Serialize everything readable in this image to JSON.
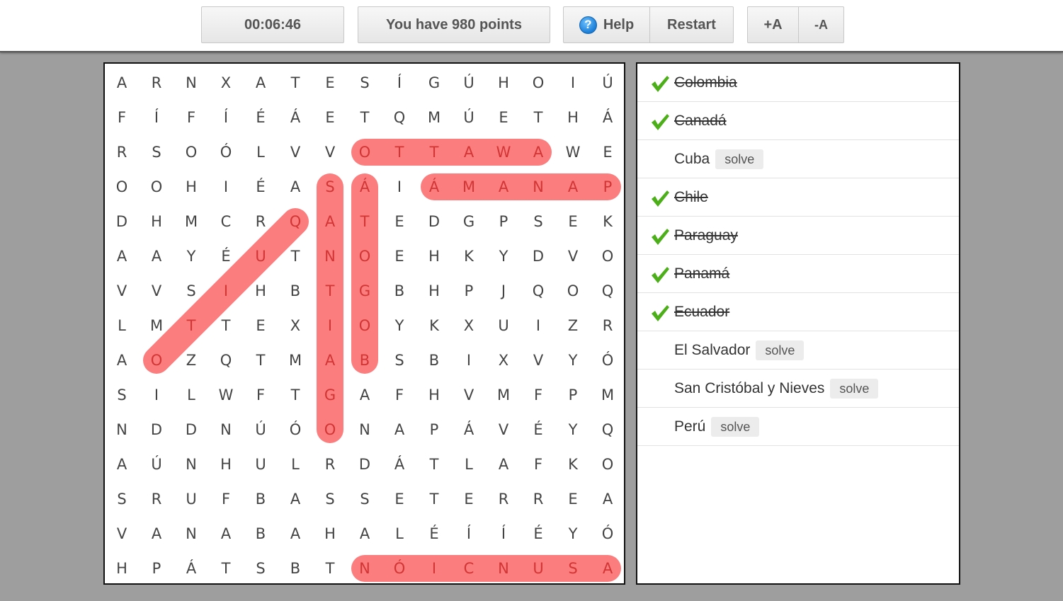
{
  "toolbar": {
    "timer": "00:06:46",
    "points": "You have 980 points",
    "help_label": "Help",
    "help_icon": "question-icon",
    "restart_label": "Restart",
    "font_increase_label": "+A",
    "font_decrease_label": "-A"
  },
  "colors": {
    "highlight": "#fb7d7d",
    "highlight_text": "#d23535",
    "check": "#4caf1a"
  },
  "grid": {
    "rows": [
      [
        "A",
        "R",
        "N",
        "X",
        "A",
        "T",
        "E",
        "S",
        "Í",
        "G",
        "Ú",
        "H",
        "O",
        "I",
        "Ú"
      ],
      [
        "F",
        "Í",
        "F",
        "Í",
        "É",
        "Á",
        "E",
        "T",
        "Q",
        "M",
        "Ú",
        "E",
        "T",
        "H",
        "Á"
      ],
      [
        "R",
        "S",
        "O",
        "Ó",
        "L",
        "V",
        "V",
        "O",
        "T",
        "T",
        "A",
        "W",
        "A",
        "W",
        "E"
      ],
      [
        "O",
        "O",
        "H",
        "I",
        "É",
        "A",
        "S",
        "Á",
        "I",
        "Á",
        "M",
        "A",
        "N",
        "A",
        "P"
      ],
      [
        "D",
        "H",
        "M",
        "C",
        "R",
        "Q",
        "A",
        "T",
        "E",
        "D",
        "G",
        "P",
        "S",
        "E",
        "K"
      ],
      [
        "A",
        "A",
        "Y",
        "É",
        "U",
        "T",
        "N",
        "O",
        "E",
        "H",
        "K",
        "Y",
        "D",
        "V",
        "O"
      ],
      [
        "V",
        "V",
        "S",
        "I",
        "H",
        "B",
        "T",
        "G",
        "B",
        "H",
        "P",
        "J",
        "Q",
        "O",
        "Q"
      ],
      [
        "L",
        "M",
        "T",
        "T",
        "E",
        "X",
        "I",
        "O",
        "Y",
        "K",
        "X",
        "U",
        "I",
        "Z",
        "R"
      ],
      [
        "A",
        "O",
        "Z",
        "Q",
        "T",
        "M",
        "A",
        "B",
        "S",
        "B",
        "I",
        "X",
        "V",
        "Y",
        "Ó"
      ],
      [
        "S",
        "I",
        "L",
        "W",
        "F",
        "T",
        "G",
        "A",
        "F",
        "H",
        "V",
        "M",
        "F",
        "P",
        "M"
      ],
      [
        "N",
        "D",
        "D",
        "N",
        "Ú",
        "Ó",
        "O",
        "N",
        "A",
        "P",
        "Á",
        "V",
        "É",
        "Y",
        "Q"
      ],
      [
        "A",
        "Ú",
        "N",
        "H",
        "U",
        "L",
        "R",
        "D",
        "Á",
        "T",
        "L",
        "A",
        "F",
        "K",
        "O"
      ],
      [
        "S",
        "R",
        "U",
        "F",
        "B",
        "A",
        "S",
        "S",
        "E",
        "T",
        "E",
        "R",
        "R",
        "E",
        "A"
      ],
      [
        "V",
        "A",
        "N",
        "A",
        "B",
        "A",
        "H",
        "A",
        "L",
        "É",
        "Í",
        "Í",
        "É",
        "Y",
        "Ó"
      ],
      [
        "H",
        "P",
        "Á",
        "T",
        "S",
        "B",
        "T",
        "N",
        "Ó",
        "I",
        "C",
        "N",
        "U",
        "S",
        "A"
      ]
    ],
    "found_words": [
      {
        "word": "OTTAWA",
        "from": [
          2,
          7
        ],
        "to": [
          2,
          12
        ]
      },
      {
        "word": "PANAMÁ",
        "from": [
          3,
          14
        ],
        "to": [
          3,
          9
        ]
      },
      {
        "word": "SANTIAGO",
        "from": [
          3,
          6
        ],
        "to": [
          10,
          6
        ]
      },
      {
        "word": "ÁTOGOB",
        "from": [
          3,
          7
        ],
        "to": [
          8,
          7
        ]
      },
      {
        "word": "QUITO",
        "from": [
          4,
          5
        ],
        "to": [
          8,
          1
        ]
      },
      {
        "word": "ASUNCIÓN",
        "from": [
          14,
          14
        ],
        "to": [
          14,
          7
        ]
      }
    ]
  },
  "word_list": [
    {
      "label": "Colombia",
      "found": true
    },
    {
      "label": "Canadá",
      "found": true
    },
    {
      "label": "Cuba",
      "found": false,
      "action": "solve"
    },
    {
      "label": "Chile",
      "found": true
    },
    {
      "label": "Paraguay",
      "found": true
    },
    {
      "label": "Panamá",
      "found": true
    },
    {
      "label": "Ecuador",
      "found": true
    },
    {
      "label": "El Salvador",
      "found": false,
      "action": "solve"
    },
    {
      "label": "San Cristóbal y Nieves",
      "found": false,
      "action": "solve"
    },
    {
      "label": "Perú",
      "found": false,
      "action": "solve"
    }
  ]
}
